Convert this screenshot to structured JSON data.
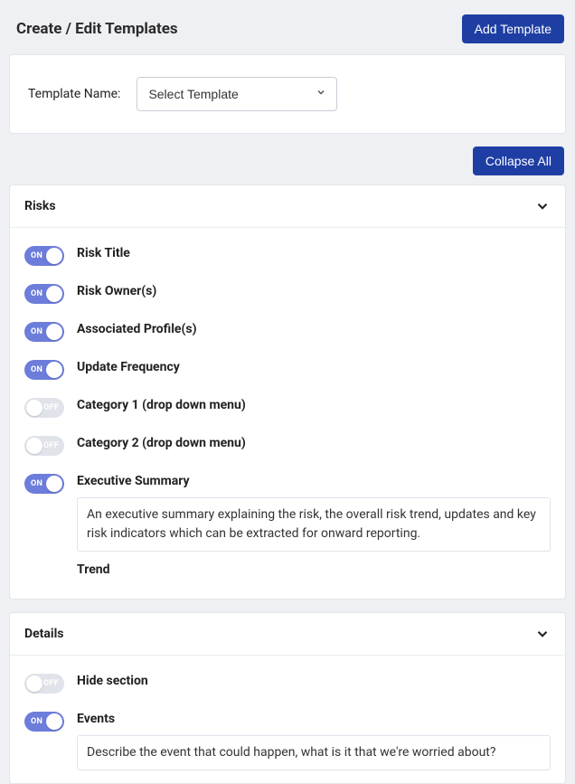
{
  "header": {
    "title": "Create / Edit Templates",
    "addButton": "Add Template"
  },
  "templateName": {
    "label": "Template Name:",
    "selected": "Select Template"
  },
  "collapseAll": "Collapse All",
  "toggleLabels": {
    "on": "ON",
    "off": "OFF"
  },
  "sections": {
    "risks": {
      "title": "Risks",
      "fields": {
        "riskTitle": "Risk Title",
        "riskOwners": "Risk Owner(s)",
        "associatedProfiles": "Associated Profile(s)",
        "updateFrequency": "Update Frequency",
        "category1": "Category 1 (drop down menu)",
        "category2": "Category 2 (drop down menu)",
        "executiveSummary": "Executive Summary",
        "executiveSummaryDesc": "An executive summary explaining the risk, the overall risk trend, updates and key risk indicators which can be extracted for onward reporting.",
        "trend": "Trend"
      }
    },
    "details": {
      "title": "Details",
      "fields": {
        "hideSection": "Hide section",
        "events": "Events",
        "eventsDesc": "Describe the event that could happen, what is it that we're worried about?"
      }
    }
  }
}
